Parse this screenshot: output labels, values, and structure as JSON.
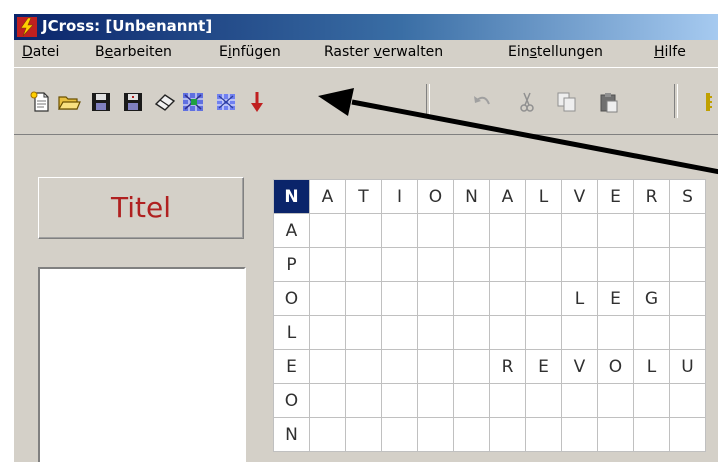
{
  "window": {
    "title": "JCross: [Unbenannt]"
  },
  "menu": [
    {
      "pre": "",
      "key": "D",
      "post": "atei"
    },
    {
      "pre": "B",
      "key": "e",
      "post": "arbeiten"
    },
    {
      "pre": "E",
      "key": "i",
      "post": "nfügen"
    },
    {
      "pre": "Raster ",
      "key": "v",
      "post": "erwalten"
    },
    {
      "pre": "Ein",
      "key": "s",
      "post": "tellungen"
    },
    {
      "pre": "",
      "key": "H",
      "post": "ilfe"
    }
  ],
  "toolbar": {
    "icons": [
      "new-document-icon",
      "open-folder-icon",
      "save-icon",
      "save-as-icon",
      "erase-icon",
      "generate-grid-icon",
      "generate-grid-alt-icon",
      "arrow-down-icon",
      "undo-icon",
      "cut-icon",
      "copy-icon",
      "paste-icon",
      "more-icon"
    ]
  },
  "left_panel": {
    "title_label": "Titel"
  },
  "grid": {
    "rows": [
      [
        "N",
        "A",
        "T",
        "I",
        "O",
        "N",
        "A",
        "L",
        "V",
        "E",
        "R",
        "S"
      ],
      [
        "A",
        "",
        "",
        "",
        "",
        "",
        "",
        "",
        "",
        "",
        "",
        ""
      ],
      [
        "P",
        "",
        "",
        "",
        "",
        "",
        "",
        "",
        "",
        "",
        "",
        ""
      ],
      [
        "O",
        "",
        "",
        "",
        "",
        "",
        "",
        "",
        "L",
        "E",
        "G",
        ""
      ],
      [
        "L",
        "",
        "",
        "",
        "",
        "",
        "",
        "",
        "",
        "",
        "",
        ""
      ],
      [
        "E",
        "",
        "",
        "",
        "",
        "",
        "R",
        "E",
        "V",
        "O",
        "L",
        "U"
      ],
      [
        "O",
        "",
        "",
        "",
        "",
        "",
        "",
        "",
        "",
        "",
        "",
        ""
      ],
      [
        "N",
        "",
        "",
        "",
        "",
        "",
        "",
        "",
        "",
        "",
        "",
        ""
      ]
    ]
  },
  "colors": {
    "titlebar_start": "#0a246a",
    "titlebar_end": "#a6caf0",
    "title_label": "#b02020",
    "selected_cell": "#0a246a"
  }
}
